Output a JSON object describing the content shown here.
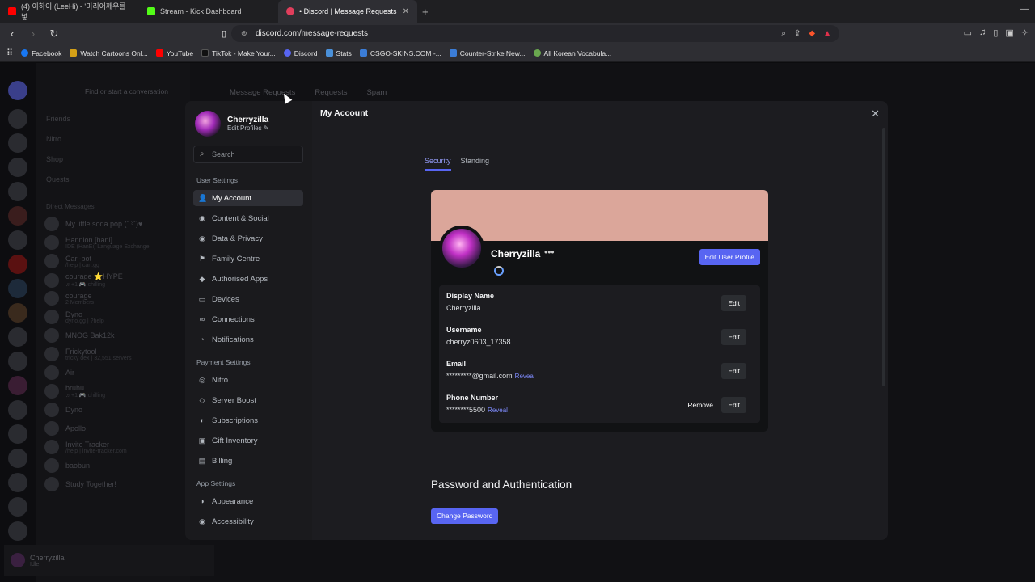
{
  "browser": {
    "tabs": [
      {
        "label": "(4) 이하이 (LeeHi) - '미리어깨우를넣",
        "color": "#ff0000"
      },
      {
        "label": "Stream - Kick Dashboard",
        "color": "#53fc18"
      },
      {
        "label": "• Discord | Message Requests",
        "color": "#e03e5c"
      }
    ],
    "url": "discord.com/message-requests",
    "bookmarks": [
      {
        "label": "Facebook",
        "color": "#1877f2"
      },
      {
        "label": "Watch Cartoons Onl...",
        "color": "#d4a017"
      },
      {
        "label": "YouTube",
        "color": "#ff0000"
      },
      {
        "label": "TikTok - Make Your...",
        "color": "#111111"
      },
      {
        "label": "Discord",
        "color": "#5865f2"
      },
      {
        "label": "Stats",
        "color": "#4a90d9"
      },
      {
        "label": "CSGO-SKINS.COM -...",
        "color": "#3b7dd8"
      },
      {
        "label": "Counter-Strike New...",
        "color": "#3b7dd8"
      },
      {
        "label": "All Korean Vocabula...",
        "color": "#6aa84f"
      }
    ]
  },
  "background": {
    "find": "Find or start a conversation",
    "topnav": [
      "Message Requests",
      "Requests",
      "Spam"
    ],
    "nav": [
      "Friends",
      "Nitro",
      "Shop",
      "Quests"
    ],
    "dm_header": "Direct Messages",
    "dms": [
      {
        "name": "My little soda pop (˘ ³˘)♥",
        "sub": ""
      },
      {
        "name": "Hannion [hani]",
        "sub": "IDE (HanEi) Language Exchange"
      },
      {
        "name": "Carl-bot",
        "sub": "/help | carl.gg"
      },
      {
        "name": "courage ⭐HYPE",
        "sub": "♬+1 🎮 chilling"
      },
      {
        "name": "courage",
        "sub": "2 Members"
      },
      {
        "name": "Dyno",
        "sub": "dyno.gg | ?help"
      },
      {
        "name": "MNOG Bak12k",
        "sub": ""
      },
      {
        "name": "Frickytool",
        "sub": "tricky dex | 32,551 servers"
      },
      {
        "name": "Air",
        "sub": ""
      },
      {
        "name": "bruhu",
        "sub": "♬+1 🎮 chilling"
      },
      {
        "name": "Dyno",
        "sub": ""
      },
      {
        "name": "Apollo",
        "sub": ""
      },
      {
        "name": "Invite Tracker",
        "sub": "/help | invite-tracker.com"
      },
      {
        "name": "baobun",
        "sub": ""
      },
      {
        "name": "Study Together!",
        "sub": ""
      }
    ],
    "user": {
      "name": "Cherryzilla",
      "status": "Idle"
    }
  },
  "settings": {
    "profile": {
      "name": "Cherryzilla",
      "edit": "Edit Profiles ✎"
    },
    "search_placeholder": "Search",
    "sections": [
      {
        "title": "User Settings",
        "items": [
          "My Account",
          "Content & Social",
          "Data & Privacy",
          "Family Centre",
          "Authorised Apps",
          "Devices",
          "Connections",
          "Notifications"
        ]
      },
      {
        "title": "Payment Settings",
        "items": [
          "Nitro",
          "Server Boost",
          "Subscriptions",
          "Gift Inventory",
          "Billing"
        ]
      },
      {
        "title": "App Settings",
        "items": [
          "Appearance",
          "Accessibility"
        ]
      }
    ],
    "active_item": "My Account"
  },
  "account": {
    "title": "My Account",
    "tabs": [
      "Security",
      "Standing"
    ],
    "username_display": "Cherryzilla",
    "dots": "•••",
    "edit_profile_btn": "Edit User Profile",
    "banner_color": "#dba69a",
    "fields": [
      {
        "label": "Display Name",
        "value": "Cherryzilla",
        "reveal": "",
        "remove": "",
        "edit": "Edit"
      },
      {
        "label": "Username",
        "value": "cherryz0603_17358",
        "reveal": "",
        "remove": "",
        "edit": "Edit"
      },
      {
        "label": "Email",
        "value": "*********@gmail.com",
        "reveal": "Reveal",
        "remove": "",
        "edit": "Edit"
      },
      {
        "label": "Phone Number",
        "value": "********5500",
        "reveal": "Reveal",
        "remove": "Remove",
        "edit": "Edit"
      }
    ],
    "password_heading": "Password and Authentication",
    "change_password_btn": "Change Password"
  },
  "colors": {
    "accent": "#5865f2",
    "link": "#7f8cff"
  }
}
